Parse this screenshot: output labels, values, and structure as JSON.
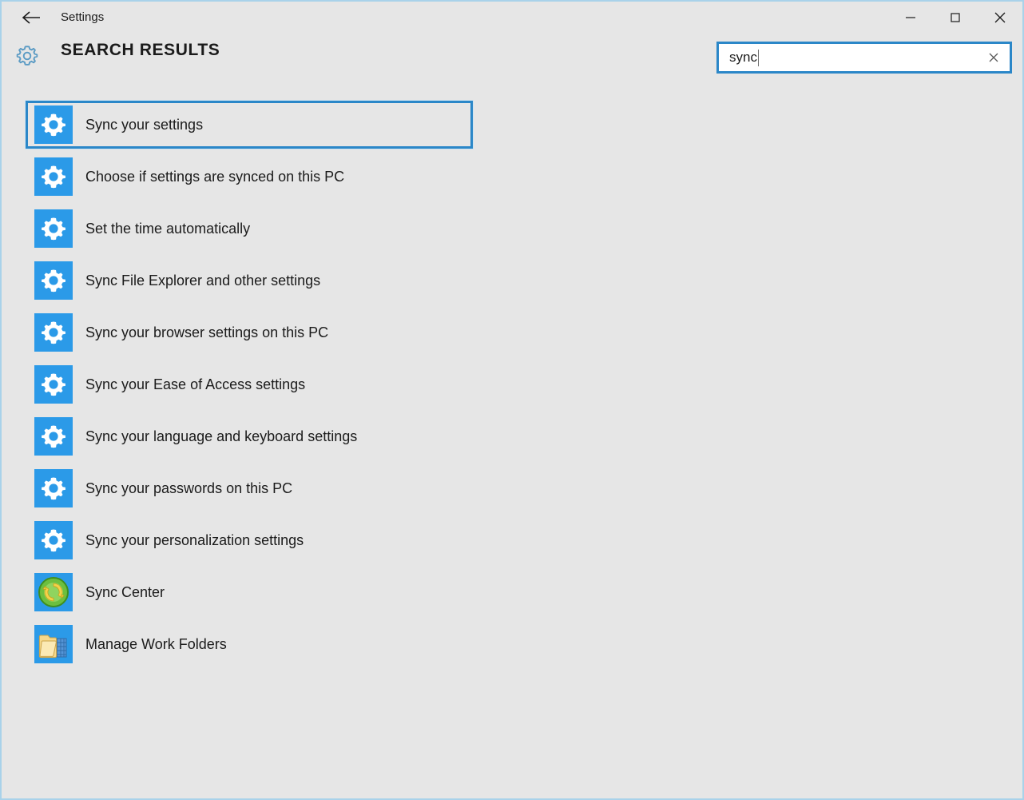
{
  "window": {
    "titlebar": {
      "back_icon": "back-arrow-icon",
      "title": "Settings",
      "minimize_label": "–",
      "maximize_label": "□",
      "close_label": "✕"
    },
    "border_color": "#a9d2ea",
    "background_color": "#e6e6e6"
  },
  "header": {
    "gear_icon": "gear-outline-icon",
    "title": "SEARCH RESULTS"
  },
  "search": {
    "value": "sync",
    "placeholder": "Search settings",
    "clear_icon": "close-icon",
    "focused": true,
    "accent_color": "#2b87c8"
  },
  "results": {
    "tile_color": "#2b9ae8",
    "items": [
      {
        "label": "Sync your settings",
        "icon": "gear-icon",
        "focused": true
      },
      {
        "label": "Choose if settings are synced on this PC",
        "icon": "gear-icon",
        "focused": false
      },
      {
        "label": "Set the time automatically",
        "icon": "gear-icon",
        "focused": false
      },
      {
        "label": "Sync File Explorer and other settings",
        "icon": "gear-icon",
        "focused": false
      },
      {
        "label": "Sync your browser settings on this PC",
        "icon": "gear-icon",
        "focused": false
      },
      {
        "label": "Sync your Ease of Access settings",
        "icon": "gear-icon",
        "focused": false
      },
      {
        "label": "Sync your language and keyboard settings",
        "icon": "gear-icon",
        "focused": false
      },
      {
        "label": "Sync your passwords on this PC",
        "icon": "gear-icon",
        "focused": false
      },
      {
        "label": "Sync your personalization settings",
        "icon": "gear-icon",
        "focused": false
      },
      {
        "label": "Sync Center",
        "icon": "sync-circle-icon",
        "focused": false
      },
      {
        "label": "Manage Work Folders",
        "icon": "work-folder-icon",
        "focused": false
      }
    ]
  }
}
